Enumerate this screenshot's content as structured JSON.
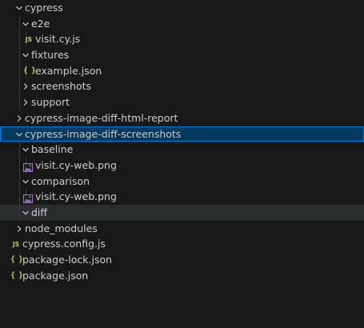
{
  "explorer": {
    "items": [
      {
        "label": "cypress",
        "kind": "folder",
        "expanded": true,
        "icon": "chevron-down-icon"
      },
      {
        "label": "e2e",
        "kind": "folder",
        "expanded": true,
        "icon": "chevron-down-icon"
      },
      {
        "label": "visit.cy.js",
        "kind": "file",
        "icon": "js-file-icon",
        "icon_text": "JS"
      },
      {
        "label": "fixtures",
        "kind": "folder",
        "expanded": true,
        "icon": "chevron-down-icon"
      },
      {
        "label": "example.json",
        "kind": "file",
        "icon": "json-file-icon",
        "icon_text": "{ }"
      },
      {
        "label": "screenshots",
        "kind": "folder",
        "expanded": false,
        "icon": "chevron-right-icon"
      },
      {
        "label": "support",
        "kind": "folder",
        "expanded": false,
        "icon": "chevron-right-icon"
      },
      {
        "label": "cypress-image-diff-html-report",
        "kind": "folder",
        "expanded": false,
        "icon": "chevron-right-icon"
      },
      {
        "label": "cypress-image-diff-screenshots",
        "kind": "folder",
        "expanded": true,
        "selected": true,
        "icon": "chevron-down-icon"
      },
      {
        "label": "baseline",
        "kind": "folder",
        "expanded": true,
        "icon": "chevron-down-icon"
      },
      {
        "label": "visit.cy-web.png",
        "kind": "file",
        "icon": "image-file-icon"
      },
      {
        "label": "comparison",
        "kind": "folder",
        "expanded": true,
        "icon": "chevron-down-icon"
      },
      {
        "label": "visit.cy-web.png",
        "kind": "file",
        "icon": "image-file-icon"
      },
      {
        "label": "diff",
        "kind": "folder",
        "expanded": true,
        "hovered": true,
        "icon": "chevron-down-icon"
      },
      {
        "label": "node_modules",
        "kind": "folder",
        "expanded": false,
        "icon": "chevron-right-icon"
      },
      {
        "label": "cypress.config.js",
        "kind": "file",
        "icon": "js-file-icon",
        "icon_text": "JS"
      },
      {
        "label": "package-lock.json",
        "kind": "file",
        "icon": "json-file-icon",
        "icon_text": "{ }"
      },
      {
        "label": "package.json",
        "kind": "file",
        "icon": "json-file-icon",
        "icon_text": "{ }"
      }
    ]
  },
  "colors": {
    "background": "#181818",
    "text": "#cccccc",
    "selection_background": "#04395e",
    "selection_border": "#0078d4",
    "hover_background": "#2a2d2e",
    "indent_guide": "#3a3a3a",
    "js_icon": "#cbcb41",
    "json_icon": "#cbcb41",
    "image_icon": "#a074c4"
  }
}
